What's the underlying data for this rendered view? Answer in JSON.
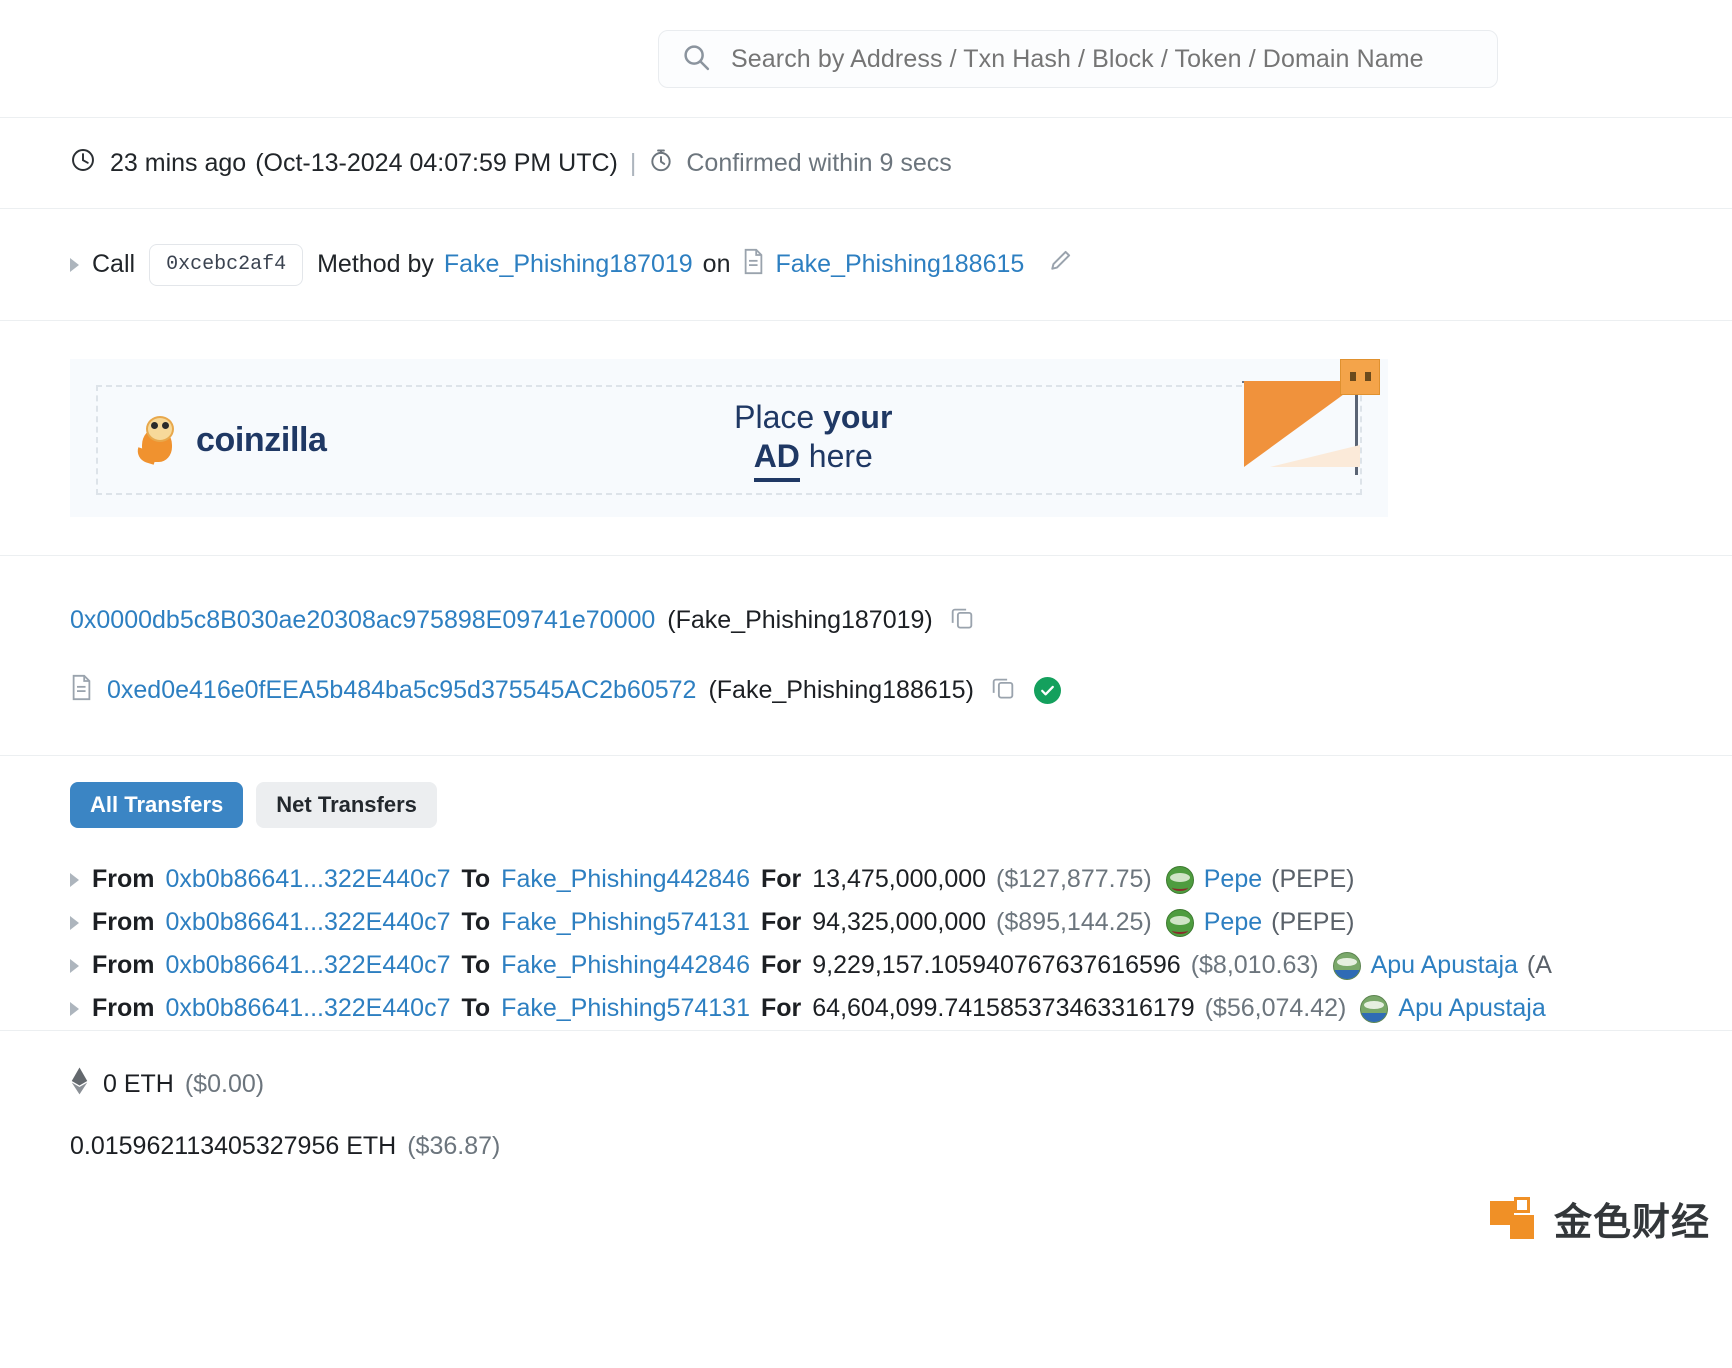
{
  "search": {
    "placeholder": "Search by Address / Txn Hash / Block / Token / Domain Name",
    "icon": "search-icon"
  },
  "timestamp": {
    "clock_icon": "clock-icon",
    "relative": "23 mins ago",
    "absolute": "(Oct-13-2024 04:07:59 PM UTC)",
    "separator": "|",
    "stopwatch_icon": "stopwatch-icon",
    "confirmation": "Confirmed within 9 secs"
  },
  "method": {
    "caret_icon": "chevron-right-icon",
    "call_label": "Call",
    "signature": "0xcebc2af4",
    "method_by_label": "Method by",
    "caller": "Fake_Phishing187019",
    "on_label": "on",
    "contract_icon": "document-icon",
    "contract": "Fake_Phishing188615",
    "edit_icon": "pencil-icon"
  },
  "ad": {
    "brand": "coinzilla",
    "mascot_icon": "coinzilla-mascot-icon",
    "line1_a": "Place ",
    "line1_b": "your",
    "line2_a": "AD",
    "line2_b": " here",
    "flag_icon": "orange-flag-icon"
  },
  "addresses": [
    {
      "hash": "0x0000db5c8B030ae20308ac975898E09741e70000",
      "tag": "(Fake_Phishing187019)",
      "has_doc_icon": false,
      "copy_icon": "copy-icon",
      "verified": false
    },
    {
      "hash": "0xed0e416e0fEEA5b484ba5c95d375545AC2b60572",
      "tag": "(Fake_Phishing188615)",
      "has_doc_icon": true,
      "doc_icon": "document-icon",
      "copy_icon": "copy-icon",
      "verified": true,
      "verified_icon": "check-circle-icon"
    }
  ],
  "tabs": [
    {
      "label": "All Transfers",
      "active": true
    },
    {
      "label": "Net Transfers",
      "active": false
    }
  ],
  "transfers": [
    {
      "caret_icon": "chevron-right-icon",
      "from_label": "From",
      "from": "0xb0b86641...322E440c7",
      "to_label": "To",
      "to": "Fake_Phishing442846",
      "for_label": "For",
      "amount": "13,475,000,000",
      "usd": "($127,877.75)",
      "token_icon": "pepe-token-icon",
      "token_name": "Pepe",
      "token_symbol": "(PEPE)"
    },
    {
      "caret_icon": "chevron-right-icon",
      "from_label": "From",
      "from": "0xb0b86641...322E440c7",
      "to_label": "To",
      "to": "Fake_Phishing574131",
      "for_label": "For",
      "amount": "94,325,000,000",
      "usd": "($895,144.25)",
      "token_icon": "pepe-token-icon",
      "token_name": "Pepe",
      "token_symbol": "(PEPE)"
    },
    {
      "caret_icon": "chevron-right-icon",
      "from_label": "From",
      "from": "0xb0b86641...322E440c7",
      "to_label": "To",
      "to": "Fake_Phishing442846",
      "for_label": "For",
      "amount": "9,229,157.105940767637616596",
      "usd": "($8,010.63)",
      "token_icon": "apu-token-icon",
      "token_name": "Apu Apustaja",
      "token_symbol": "(A"
    },
    {
      "caret_icon": "chevron-right-icon",
      "from_label": "From",
      "from": "0xb0b86641...322E440c7",
      "to_label": "To",
      "to": "Fake_Phishing574131",
      "for_label": "For",
      "amount": "64,604,099.741585373463316179",
      "usd": "($56,074.42)",
      "token_icon": "apu-token-icon",
      "token_name": "Apu Apustaja",
      "token_symbol": ""
    }
  ],
  "eth_section": {
    "diamond_icon": "ethereum-diamond-icon",
    "value_row1": "0 ETH",
    "usd_row1": "($0.00)",
    "value_row2": "0.015962113405327956 ETH",
    "usd_row2": "($36.87)"
  },
  "watermark": {
    "text": "金色财经",
    "logo_icon": "jinse-logo-icon"
  },
  "colors": {
    "link": "#2d7fc1",
    "tab_active_bg": "#3b85c4",
    "tab_idle_bg": "#eceef0",
    "verified_green": "#14a05d",
    "ad_navy": "#1f3864",
    "ad_orange": "#f0923c",
    "muted_text": "#6c757d"
  }
}
